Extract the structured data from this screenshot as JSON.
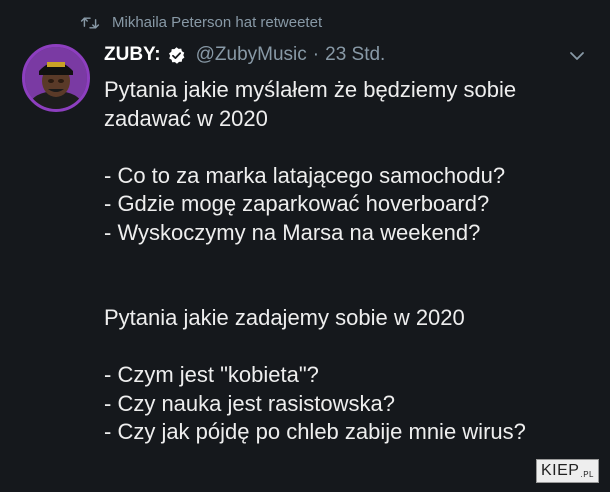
{
  "retweet": {
    "icon": "retweet-icon",
    "text": "Mikhaila Peterson hat retweetet"
  },
  "tweet": {
    "display_name": "ZUBY:",
    "verified_icon": "verified-badge-icon",
    "handle": "@ZubyMusic",
    "separator": "·",
    "time": "23 Std.",
    "menu_icon": "chevron-down-icon",
    "body": "Pytania jakie myślałem że będziemy sobie zadawać w 2020\n\n- Co to za marka latającego samochodu?\n- Gdzie mogę zaparkować hoverboard?\n- Wyskoczymy na Marsa na weekend?\n\n\nPytania jakie zadajemy sobie w 2020\n\n- Czym jest \"kobieta\"?\n- Czy nauka jest rasistowska?\n- Czy jak pójdę po chleb zabije mnie wirus?"
  },
  "watermark": {
    "main": "KIEP",
    "suffix": ".PL"
  },
  "colors": {
    "background": "#15181c",
    "secondary_text": "#8899a6",
    "verified": "#ffffff",
    "avatar_ring": "#8d3fbf"
  }
}
